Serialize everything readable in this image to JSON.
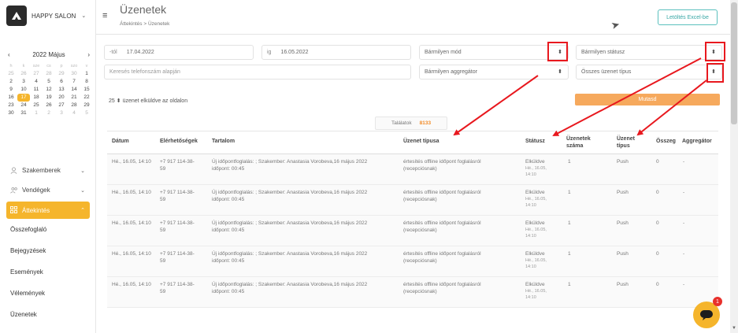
{
  "app": {
    "name": "HAPPY SALON",
    "caret": "⌄"
  },
  "calendar": {
    "month_label": "2022 Május",
    "prev": "‹",
    "next": "›",
    "weekdays": [
      "h",
      "k",
      "sze",
      "cs",
      "p",
      "szo",
      "v"
    ],
    "weeks": [
      [
        {
          "d": "25",
          "dim": true
        },
        {
          "d": "26",
          "dim": true
        },
        {
          "d": "27",
          "dim": true
        },
        {
          "d": "28",
          "dim": true
        },
        {
          "d": "29",
          "dim": true
        },
        {
          "d": "30",
          "dim": true
        },
        {
          "d": "1"
        }
      ],
      [
        {
          "d": "2"
        },
        {
          "d": "3"
        },
        {
          "d": "4"
        },
        {
          "d": "5"
        },
        {
          "d": "6"
        },
        {
          "d": "7"
        },
        {
          "d": "8"
        }
      ],
      [
        {
          "d": "9"
        },
        {
          "d": "10"
        },
        {
          "d": "11"
        },
        {
          "d": "12"
        },
        {
          "d": "13"
        },
        {
          "d": "14"
        },
        {
          "d": "15"
        }
      ],
      [
        {
          "d": "16"
        },
        {
          "d": "17",
          "today": true
        },
        {
          "d": "18"
        },
        {
          "d": "19"
        },
        {
          "d": "20"
        },
        {
          "d": "21"
        },
        {
          "d": "22"
        }
      ],
      [
        {
          "d": "23"
        },
        {
          "d": "24"
        },
        {
          "d": "25"
        },
        {
          "d": "26"
        },
        {
          "d": "27"
        },
        {
          "d": "28"
        },
        {
          "d": "29"
        }
      ],
      [
        {
          "d": "30"
        },
        {
          "d": "31"
        },
        {
          "d": "1",
          "dim": true
        },
        {
          "d": "2",
          "dim": true
        },
        {
          "d": "3",
          "dim": true
        },
        {
          "d": "4",
          "dim": true
        },
        {
          "d": "5",
          "dim": true
        }
      ]
    ]
  },
  "nav": {
    "specialists": "Szakemberek",
    "guests": "Vendégek",
    "overview": "Áttekintés",
    "sub": [
      "Összefoglaló",
      "Bejegyzések",
      "Események",
      "Vélemények",
      "Üzenetek"
    ]
  },
  "header": {
    "title": "Üzenetek",
    "breadcrumb": "Áttekintés  >  Üzenetek",
    "excel_button": "Letöltés Excel-be"
  },
  "filters": {
    "from_label": "-tól",
    "from_value": "17.04.2022",
    "to_label": "ig",
    "to_value": "16.05.2022",
    "mode": "Bármilyen mód",
    "status": "Bármilyen státusz",
    "phone_placeholder": "Keresés telefonszám alapján",
    "aggregator": "Bármilyen aggregátor",
    "message_type": "Összes üzenet típus",
    "per_page_value": "25",
    "per_page_label": "üzenet elküldve az oldalon",
    "show_button": "Mutasd"
  },
  "results": {
    "label": "Találatok",
    "count": "8133"
  },
  "table": {
    "headers": {
      "date": "Dátum",
      "contacts": "Elérhetőségek",
      "content": "Tartalom",
      "type": "Üzenet típusa",
      "status": "Státusz",
      "count1": "Üzenetek",
      "count2": "száma",
      "kind1": "Üzenet",
      "kind2": "típus",
      "amount": "Összeg",
      "aggregator": "Aggregátor"
    },
    "rows": [
      {
        "date": "Hé., 16.05, 14:10",
        "phone1": "+7 917 114-38-",
        "phone2": "59",
        "content1": "Új időpontfoglalás: ; Szakember: Anastasia Vorobeva,16 május 2022",
        "content2": "időpont: 00:45",
        "type1": "értesítés offline időpont foglalásról",
        "type2": "(recepciósnak)",
        "status": "Elküldve",
        "status_time1": "Hé., 16.05,",
        "status_time2": "14:10",
        "count": "1",
        "kind": "Push",
        "amount": "0",
        "agg": "-"
      },
      {
        "date": "Hé., 16.05, 14:10",
        "phone1": "+7 917 114-38-",
        "phone2": "59",
        "content1": "Új időpontfoglalás: ; Szakember: Anastasia Vorobeva,16 május 2022",
        "content2": "időpont: 00:45",
        "type1": "értesítés offline időpont foglalásról",
        "type2": "(recepciósnak)",
        "status": "Elküldve",
        "status_time1": "Hé., 16.05,",
        "status_time2": "14:10",
        "count": "1",
        "kind": "Push",
        "amount": "0",
        "agg": "-"
      },
      {
        "date": "Hé., 16.05, 14:10",
        "phone1": "+7 917 114-38-",
        "phone2": "59",
        "content1": "Új időpontfoglalás: ; Szakember: Anastasia Vorobeva,16 május 2022",
        "content2": "időpont: 00:45",
        "type1": "értesítés offline időpont foglalásról",
        "type2": "(recepciósnak)",
        "status": "Elküldve",
        "status_time1": "Hé., 16.05,",
        "status_time2": "14:10",
        "count": "1",
        "kind": "Push",
        "amount": "0",
        "agg": "-"
      },
      {
        "date": "Hé., 16.05, 14:10",
        "phone1": "+7 917 114-38-",
        "phone2": "59",
        "content1": "Új időpontfoglalás: ; Szakember: Anastasia Vorobeva,16 május 2022",
        "content2": "időpont: 00:45",
        "type1": "értesítés offline időpont foglalásról",
        "type2": "(recepciósnak)",
        "status": "Elküldve",
        "status_time1": "Hé., 16.05,",
        "status_time2": "14:10",
        "count": "1",
        "kind": "Push",
        "amount": "0",
        "agg": "-"
      },
      {
        "date": "Hé., 16.05, 14:10",
        "phone1": "+7 917 114-38-",
        "phone2": "59",
        "content1": "Új időpontfoglalás: ; Szakember: Anastasia Vorobeva,16 május 2022",
        "content2": "időpont: 00:45",
        "type1": "értesítés offline időpont foglalásról",
        "type2": "(recepciósnak)",
        "status": "Elküldve",
        "status_time1": "Hé., 16.05,",
        "status_time2": "14:10",
        "count": "1",
        "kind": "Push",
        "amount": "0",
        "agg": "-"
      }
    ]
  },
  "chat": {
    "badge": "1"
  },
  "colors": {
    "accent": "#f5b52c",
    "annotation": "#e8181e",
    "teal": "#5bc0be",
    "orange_button": "#f6a95d"
  },
  "icons": [
    "logo-icon",
    "hamburger-icon",
    "cursor-icon",
    "dropdown-icon",
    "user-icon",
    "users-icon",
    "grid-icon",
    "chat-icon"
  ]
}
